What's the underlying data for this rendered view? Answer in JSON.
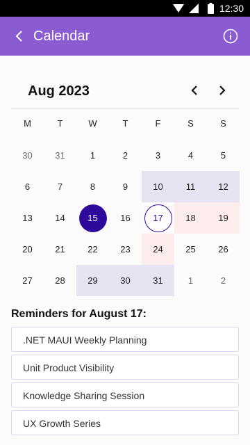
{
  "status_bar": {
    "time": "12:30",
    "icons": [
      "wifi-icon",
      "signal-icon",
      "battery-icon"
    ]
  },
  "app_bar": {
    "title": "Calendar",
    "back_icon": "back-arrow-icon",
    "info_icon": "info-icon",
    "color": "#8a5bd1"
  },
  "calendar": {
    "month_label": "Aug 2023",
    "weekdays": [
      "M",
      "T",
      "W",
      "T",
      "F",
      "S",
      "S"
    ],
    "weeks": [
      [
        {
          "day": "30",
          "other": true
        },
        {
          "day": "31",
          "other": true
        },
        {
          "day": "1"
        },
        {
          "day": "2"
        },
        {
          "day": "3"
        },
        {
          "day": "4"
        },
        {
          "day": "5"
        }
      ],
      [
        {
          "day": "6"
        },
        {
          "day": "7"
        },
        {
          "day": "8"
        },
        {
          "day": "9"
        },
        {
          "day": "10",
          "bg": "lav"
        },
        {
          "day": "11",
          "bg": "lav"
        },
        {
          "day": "12",
          "bg": "lav"
        }
      ],
      [
        {
          "day": "13"
        },
        {
          "day": "14"
        },
        {
          "day": "15",
          "state": "today"
        },
        {
          "day": "16"
        },
        {
          "day": "17",
          "state": "selected"
        },
        {
          "day": "18",
          "bg": "pink"
        },
        {
          "day": "19",
          "bg": "pink"
        }
      ],
      [
        {
          "day": "20"
        },
        {
          "day": "21"
        },
        {
          "day": "22"
        },
        {
          "day": "23"
        },
        {
          "day": "24",
          "bg": "pink"
        },
        {
          "day": "25"
        },
        {
          "day": "26"
        }
      ],
      [
        {
          "day": "27"
        },
        {
          "day": "28"
        },
        {
          "day": "29",
          "bg": "lav"
        },
        {
          "day": "30",
          "bg": "lav"
        },
        {
          "day": "31",
          "bg": "lav"
        },
        {
          "day": "1",
          "other": true
        },
        {
          "day": "2",
          "other": true
        }
      ]
    ],
    "colors": {
      "today": "#2e0a9a",
      "range_lavender": "#e5e3f2",
      "range_pink": "#fcecec"
    }
  },
  "reminders": {
    "title": "Reminders for August 17:",
    "items": [
      ".NET MAUI Weekly Planning",
      "Unit Product Visibility",
      "Knowledge Sharing Session",
      "UX Growth Series"
    ]
  }
}
